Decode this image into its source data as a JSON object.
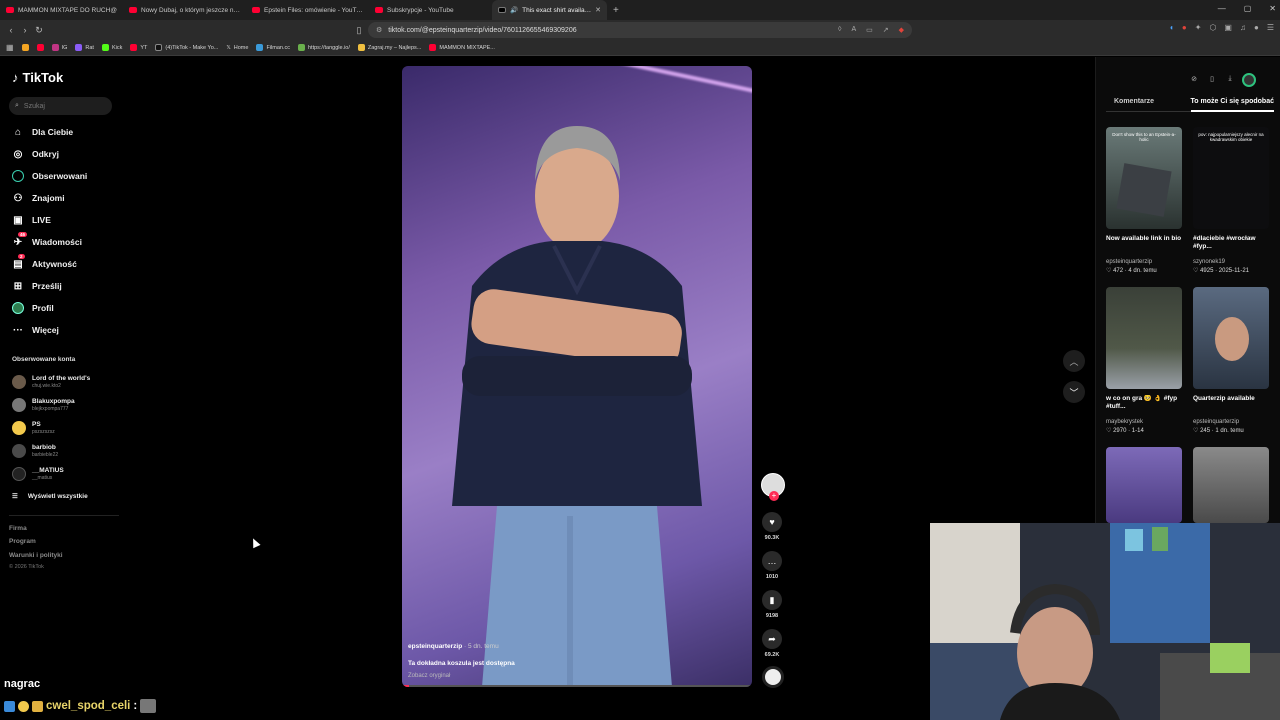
{
  "browser": {
    "tabs": [
      {
        "title": "MAMMON MIXTAPE DO RUCH@"
      },
      {
        "title": "Nowy Dubaj, o którym jeszcze nie sł"
      },
      {
        "title": "Epstein Files: omówienie - YouTube"
      },
      {
        "title": "Subskrypcje - YouTube"
      },
      {
        "title": "This exact shirt available | Tik",
        "active": true
      }
    ],
    "url": "tiktok.com/@epsteinquarterzip/video/7601126655469309206",
    "bookmarks": [
      "IG",
      "Rat",
      "Kick",
      "YT",
      "(4)TikTok - Make Yo...",
      "Home",
      "Filman.cc",
      "https://tanggle.io/",
      "Zagraj.my – Najleps...",
      "MAMMON MIXTAPE..."
    ]
  },
  "sidebar": {
    "logo": "TikTok",
    "search_placeholder": "Szukaj",
    "nav": [
      {
        "label": "Dla Ciebie",
        "icon": "home-icon"
      },
      {
        "label": "Odkryj",
        "icon": "compass-icon"
      },
      {
        "label": "Obserwowani",
        "icon": "following-icon"
      },
      {
        "label": "Znajomi",
        "icon": "friends-icon"
      },
      {
        "label": "LIVE",
        "icon": "live-icon"
      },
      {
        "label": "Wiadomości",
        "icon": "messages-icon",
        "badge": "46"
      },
      {
        "label": "Aktywność",
        "icon": "activity-icon",
        "badge": "2"
      },
      {
        "label": "Prześlij",
        "icon": "upload-icon"
      },
      {
        "label": "Profil",
        "icon": "profile-icon"
      },
      {
        "label": "Więcej",
        "icon": "more-icon"
      }
    ],
    "followed_header": "Obserwowane konta",
    "followed": [
      {
        "name": "Lord of the world's",
        "handle": "chuj.wie.kto2"
      },
      {
        "name": "Blakuxpompa",
        "handle": "blejkxpompa777"
      },
      {
        "name": "PS",
        "handle": "pszszszsz"
      },
      {
        "name": "barbiob",
        "handle": "barbieble22"
      },
      {
        "name": "__MATIUS",
        "handle": "__matius"
      }
    ],
    "show_all": "Wyświetl wszystkie",
    "footer": [
      "Firma",
      "Program",
      "Warunki i polityki"
    ],
    "copyright": "© 2026 TikTok"
  },
  "video": {
    "author": "epsteinquarterzip",
    "date": "· 5 dn. temu",
    "caption": "Ta dokładna koszula jest dostępna",
    "sound": "Zobacz oryginał",
    "progress": 0.02,
    "likes": "90.3K",
    "comments": "1010",
    "saves": "9198",
    "shares": "69.2K"
  },
  "right_panel": {
    "tabs": [
      "Komentarze",
      "To może Ci się spodobać"
    ],
    "active_tab": 1,
    "cards": [
      {
        "title": "Now available link in bio",
        "author": "epsteinquarterzip",
        "likes": "472",
        "date": "4 dn. temu",
        "thumb_text": "Don't show this to an Epstein-a-holic"
      },
      {
        "title": "#dlaciebie #wrocław #fyp...",
        "author": "szynonek19",
        "likes": "4925",
        "date": "2025-11-21",
        "thumb_text": "pov: najpopularniejszy alecnir na kwadrawskim obiekie"
      },
      {
        "title": "w co on gra 🥺 👌 #fyp #tuff...",
        "author": "maybekrystek",
        "likes": "2970",
        "date": "1-14",
        "thumb_text": ""
      },
      {
        "title": "Quarterzip available",
        "author": "epsteinquarterzip",
        "likes": "245",
        "date": "1 dn. temu",
        "thumb_text": ""
      },
      {
        "title": "",
        "author": "",
        "likes": "",
        "date": "",
        "thumb_text": ""
      },
      {
        "title": "",
        "author": "",
        "likes": "",
        "date": "",
        "thumb_text": ""
      }
    ]
  },
  "chat": {
    "name": "nagrac",
    "user": "cwel_spod_celi",
    "sep": ":"
  },
  "colors": {
    "accent": "#fe2c55",
    "bg": "#000000",
    "panel": "#0b0b0b"
  }
}
